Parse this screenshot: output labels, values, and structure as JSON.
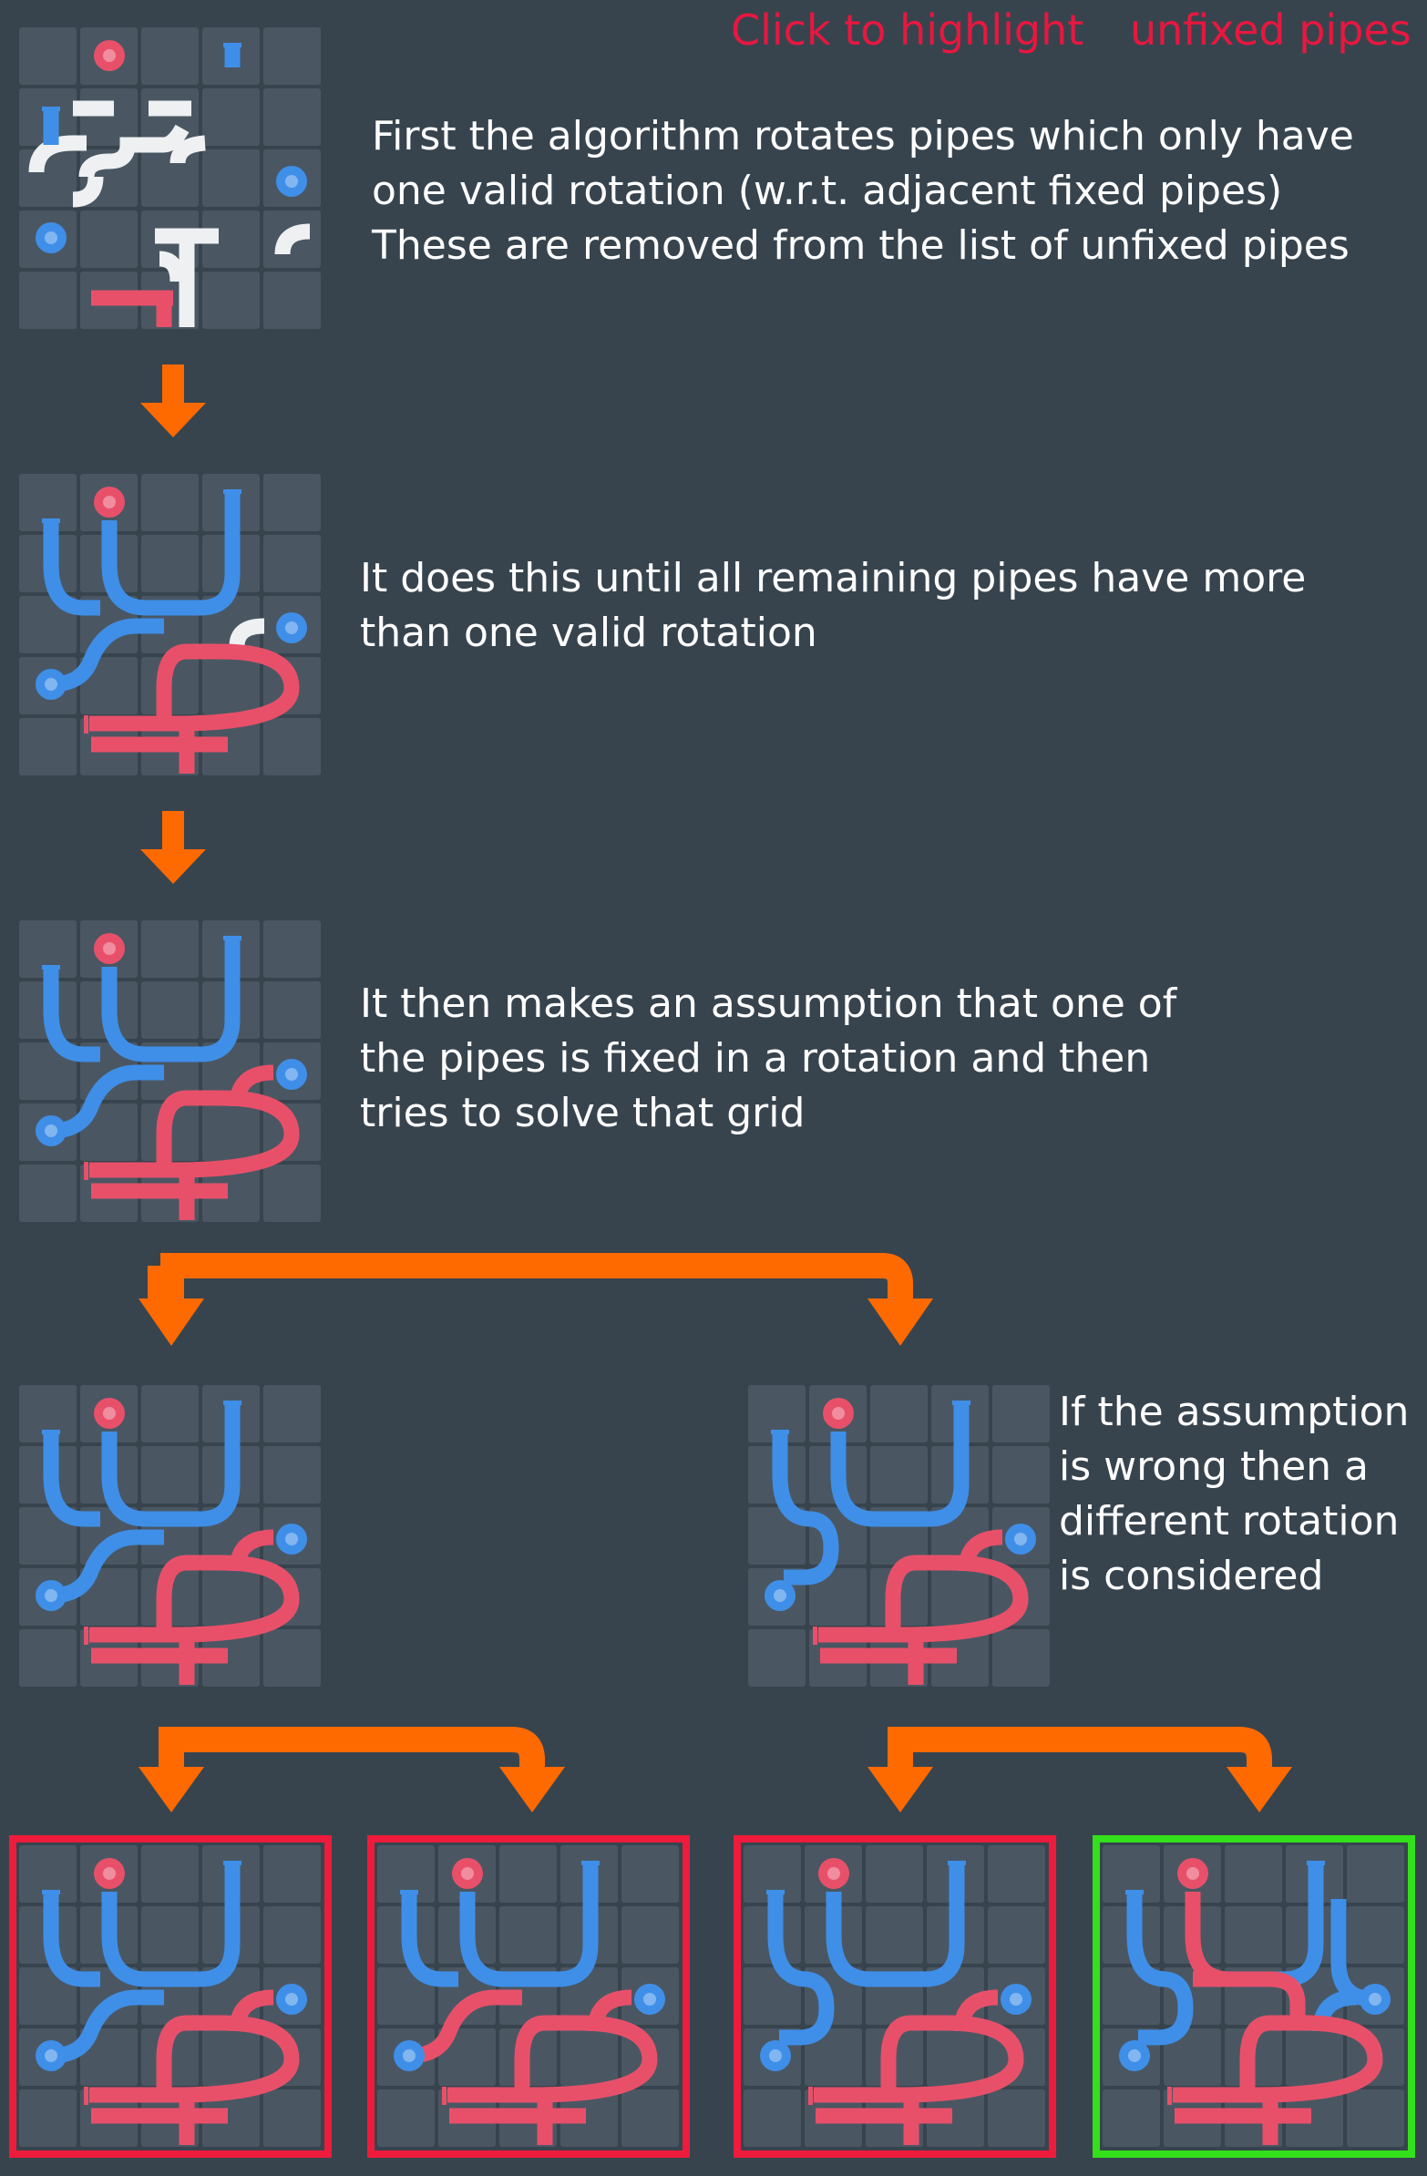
{
  "toggles": {
    "highlight": "Click to highlight",
    "unfixed": "unfixed pipes"
  },
  "steps": [
    {
      "lines": [
        "First the algorithm rotates pipes which only have",
        "one valid rotation (w.r.t. adjacent fixed pipes)",
        "These are removed from the list of unfixed pipes"
      ]
    },
    {
      "lines": [
        "It does this until all remaining pipes have more",
        "than one valid rotation"
      ]
    },
    {
      "lines": [
        "It then makes an assumption that one of",
        "the pipes is fixed in a rotation and then",
        "tries to solve that grid"
      ]
    },
    {
      "lines": [
        "If the assumption",
        "is wrong then a",
        "different rotation",
        "is considered"
      ]
    }
  ],
  "colors": {
    "background": "#37444e",
    "tile": "#4a5763",
    "pipe_blue": "#3f8fe8",
    "pipe_red": "#e8506a",
    "pipe_unfixed": "#eef0f2",
    "arrow": "#ff6a00",
    "wrong_frame": "#ee1b3c",
    "correct_frame": "#33e01b",
    "toggle_text": "#e8173f"
  },
  "puzzle": {
    "grid_size": [
      5,
      5
    ],
    "sources": [
      "blue-source-left",
      "blue-source-right",
      "red-source-top",
      "blue-tap-top-left",
      "blue-tap-top",
      "red-tap-bottom"
    ],
    "stages": [
      {
        "name": "initial",
        "fixed": false
      },
      {
        "name": "propagated",
        "fixed": true
      },
      {
        "name": "assumption",
        "fixed": true
      },
      {
        "name": "branch-a",
        "result": "continue"
      },
      {
        "name": "branch-b",
        "result": "continue"
      },
      {
        "name": "leaf-1",
        "result": "wrong"
      },
      {
        "name": "leaf-2",
        "result": "wrong"
      },
      {
        "name": "leaf-3",
        "result": "wrong"
      },
      {
        "name": "leaf-4",
        "result": "correct"
      }
    ]
  }
}
